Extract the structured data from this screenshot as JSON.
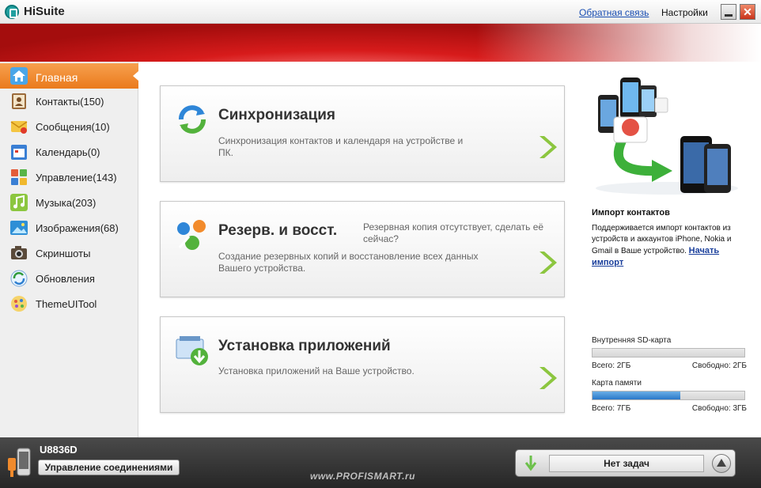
{
  "window": {
    "title": "HiSuite",
    "feedback_link": "Обратная связь",
    "settings_link": "Настройки",
    "close_glyph": "✕"
  },
  "sidebar": {
    "items": [
      {
        "label": "Главная",
        "icon": "home-icon"
      },
      {
        "label": "Контакты(150)",
        "icon": "contacts-icon"
      },
      {
        "label": "Сообщения(10)",
        "icon": "messages-icon"
      },
      {
        "label": "Календарь(0)",
        "icon": "calendar-icon"
      },
      {
        "label": "Управление(143)",
        "icon": "apps-icon"
      },
      {
        "label": "Музыка(203)",
        "icon": "music-icon"
      },
      {
        "label": "Изображения(68)",
        "icon": "images-icon"
      },
      {
        "label": "Скриншоты",
        "icon": "camera-icon"
      },
      {
        "label": "Обновления",
        "icon": "update-icon"
      },
      {
        "label": "ThemeUITool",
        "icon": "theme-icon"
      }
    ]
  },
  "cards": {
    "sync": {
      "title": "Синхронизация",
      "desc": "Синхронизация контактов и календаря на устройстве и ПК."
    },
    "backup": {
      "title": "Резерв. и восст.",
      "desc": "Создание резервных копий и восстановление всех данных Вашего устройства.",
      "side_note": "Резервная копия отсутствует, сделать её сейчас?"
    },
    "install": {
      "title": "Установка приложений",
      "desc": "Установка приложений на Ваше устройство."
    }
  },
  "promo": {
    "title": "Импорт контактов",
    "text": "Поддерживается импорт контактов из устройств и аккаунтов iPhone, Nokia и Gmail в Ваше устройство.",
    "link": "Начать импорт"
  },
  "storage": [
    {
      "label": "Внутренняя SD-карта",
      "total": "Всего: 2ГБ",
      "free": "Свободно: 2ГБ",
      "used_fraction": 0.0
    },
    {
      "label": "Карта памяти",
      "total": "Всего: 7ГБ",
      "free": "Свободно: 3ГБ",
      "used_fraction": 0.58
    }
  ],
  "bottom": {
    "device": "U8836D",
    "connection_button": "Управление соединениями",
    "watermark": "www.PROFISMART.ru",
    "tasks": "Нет задач"
  },
  "colors": {
    "active_nav": "#ea7a1c",
    "banner": "#c91414",
    "progress": "#2a78c8"
  }
}
